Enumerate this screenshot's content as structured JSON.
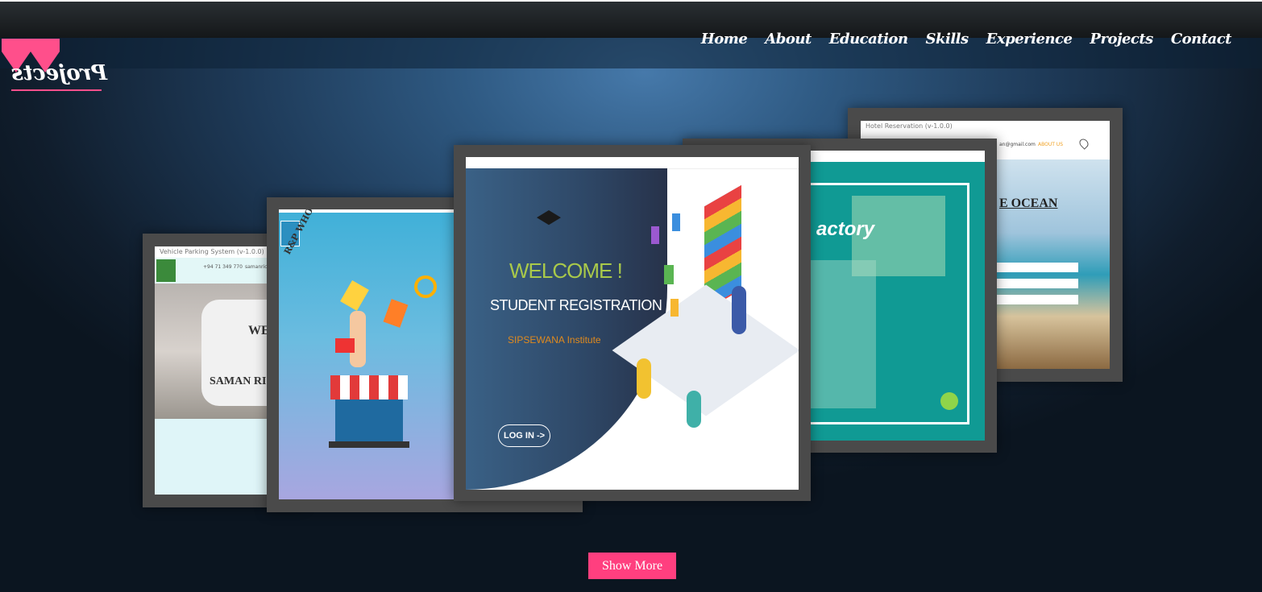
{
  "nav": {
    "items": [
      "Home",
      "About",
      "Education",
      "Skills",
      "Experience",
      "Projects",
      "Contact"
    ]
  },
  "section": {
    "title": "Projects"
  },
  "cards": {
    "card1": {
      "window_title": "Vehicle Parking System (v-1.0.0)",
      "phone": "+94 71 349 770",
      "email": "samanrich@gmail.com",
      "heading": "WE",
      "name": "SAMAN RICH"
    },
    "card2": {
      "brand": "R&P WHOLESALE DISTRIBUTORS"
    },
    "card3": {
      "welcome": "WELCOME !",
      "subtitle": "STUDENT REGISTRATION",
      "institute": "SIPSEWANA Institute",
      "login": "LOG IN ->"
    },
    "card4": {
      "heading": "actory"
    },
    "card5": {
      "window_title": "Hotel Reservation (v-1.0.0)",
      "email": "an@gmail.com",
      "about": "ABOUT US",
      "heading": "E OCEAN"
    }
  },
  "actions": {
    "show_more": "Show More"
  },
  "colors": {
    "accent": "#ff3f7f",
    "card_frame": "#4a4a4a"
  }
}
